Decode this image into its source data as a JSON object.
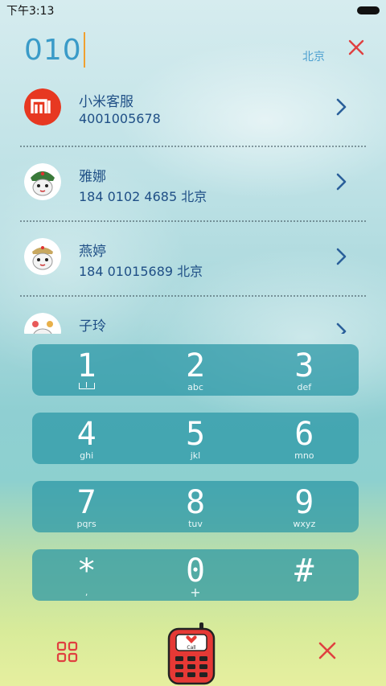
{
  "status": {
    "time": "下午3:13"
  },
  "dialer": {
    "input_value": "010",
    "location": "北京"
  },
  "contacts": [
    {
      "name": "小米客服",
      "number": "4001005678",
      "avatar": "mi-logo-icon"
    },
    {
      "name": "雅娜",
      "number": "184 0102 4685  北京",
      "avatar": "mitu-avatar-icon"
    },
    {
      "name": "燕婷",
      "number": "184 01015689  北京",
      "avatar": "mitu-avatar-icon"
    },
    {
      "name": "子玲",
      "number": "",
      "avatar": "mitu-avatar-icon"
    }
  ],
  "keypad": [
    [
      {
        "digit": "1",
        "letters": ""
      },
      {
        "digit": "2",
        "letters": "abc"
      },
      {
        "digit": "3",
        "letters": "def"
      }
    ],
    [
      {
        "digit": "4",
        "letters": "ghi"
      },
      {
        "digit": "5",
        "letters": "jkl"
      },
      {
        "digit": "6",
        "letters": "mno"
      }
    ],
    [
      {
        "digit": "7",
        "letters": "pqrs"
      },
      {
        "digit": "8",
        "letters": "tuv"
      },
      {
        "digit": "9",
        "letters": "wxyz"
      }
    ],
    [
      {
        "digit": "*",
        "letters": ","
      },
      {
        "digit": "0",
        "letters": "+"
      },
      {
        "digit": "#",
        "letters": ""
      }
    ]
  ],
  "bottom": {
    "left_icon": "grid-icon",
    "center_icon": "call-phone-icon",
    "call_label": "Call",
    "right_icon": "delete-icon"
  },
  "colors": {
    "accent_blue": "#3a9bc8",
    "name_blue": "#1f4f86",
    "clear_red": "#e04040",
    "key_teal": "#2896a5"
  }
}
